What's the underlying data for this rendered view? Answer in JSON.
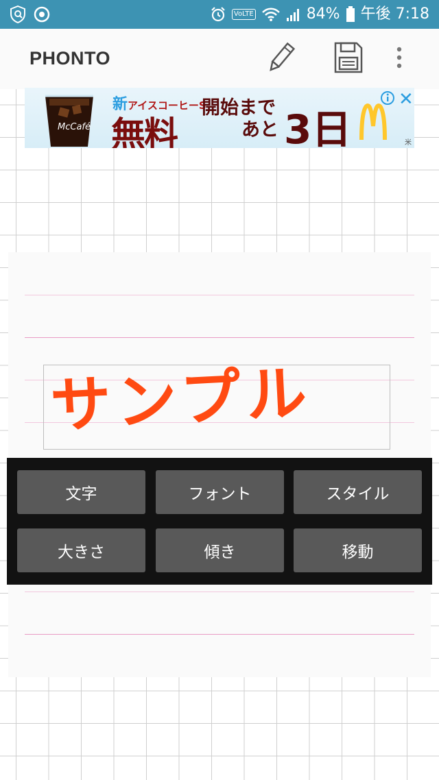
{
  "status_bar": {
    "battery": "84%",
    "time": "午後 7:18",
    "volte": "VoLTE",
    "colors": {
      "bar": "#3d93b3"
    }
  },
  "app_bar": {
    "title": "PHONTO",
    "icons": [
      "pencil-icon",
      "save-icon",
      "more-vert-icon"
    ]
  },
  "ad": {
    "headline_new": "新",
    "headline": "アイスコーヒーS",
    "big": "無料",
    "line_a": "開始まで",
    "line_b": "あと",
    "days": "3日",
    "cup_label": "McCafé",
    "small": "米"
  },
  "canvas": {
    "sample_text": "サンプル",
    "text_color": "#ff4a12"
  },
  "panel": {
    "buttons": [
      {
        "label": "文字"
      },
      {
        "label": "フォント"
      },
      {
        "label": "スタイル"
      },
      {
        "label": "大きさ"
      },
      {
        "label": "傾き"
      },
      {
        "label": "移動"
      }
    ]
  }
}
